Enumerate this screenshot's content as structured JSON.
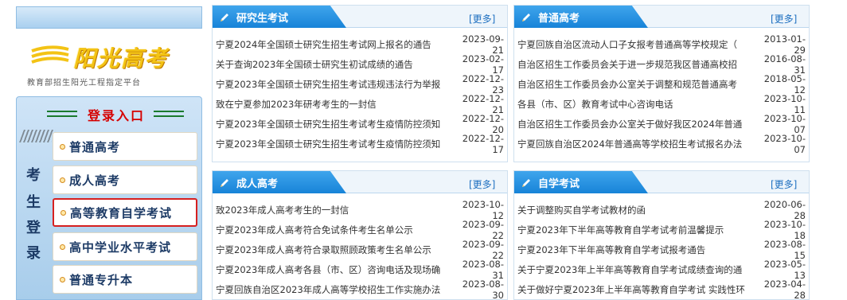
{
  "logo": {
    "title": "阳光高考",
    "subtitle": "教育部招生阳光工程指定平台"
  },
  "login": {
    "title": "登录入口",
    "side_chars": [
      "考",
      "生",
      "登",
      "录"
    ],
    "menu": [
      {
        "label": "普通高考"
      },
      {
        "label": "成人高考"
      },
      {
        "label": "高等教育自学考试"
      },
      {
        "label": "高中学业水平考试"
      },
      {
        "label": "普通专升本"
      }
    ]
  },
  "panels": [
    {
      "title": "研究生考试",
      "more": "[更多]",
      "items": [
        {
          "title": "宁夏2024年全国硕士研究生招生考试网上报名的通告",
          "date": "2023-09-21"
        },
        {
          "title": "关于查询2023年全国硕士研究生初试成绩的通告",
          "date": "2023-02-17"
        },
        {
          "title": "宁夏2023年全国硕士研究生招生考试违规违法行为举报",
          "date": "2022-12-23"
        },
        {
          "title": "致在宁夏参加2023年研考考生的一封信",
          "date": "2022-12-21"
        },
        {
          "title": "宁夏2023年全国硕士研究生招生考试考生疫情防控须知",
          "date": "2022-12-20"
        },
        {
          "title": "宁夏2023年全国硕士研究生招生考试考生疫情防控须知",
          "date": "2022-12-17"
        }
      ]
    },
    {
      "title": "普通高考",
      "more": "[更多]",
      "items": [
        {
          "title": "宁夏回族自治区流动人口子女报考普通高等学校规定（",
          "date": "2013-01-29"
        },
        {
          "title": "自治区招生工作委员会关于进一步规范我区普通高校招",
          "date": "2016-08-31"
        },
        {
          "title": "自治区招生工作委员会办公室关于调整和规范普通高考",
          "date": "2018-05-12"
        },
        {
          "title": "各县（市、区）教育考试中心咨询电话",
          "date": "2023-10-11"
        },
        {
          "title": "自治区招生工作委员会办公室关于做好我区2024年普通",
          "date": "2023-10-07"
        },
        {
          "title": "宁夏回族自治区2024年普通高等学校招生考试报名办法",
          "date": "2023-10-07"
        }
      ]
    },
    {
      "title": "成人高考",
      "more": "[更多]",
      "items": [
        {
          "title": "致2023年成人高考考生的一封信",
          "date": "2023-10-12"
        },
        {
          "title": "宁夏2023年成人高考符合免试条件考生名单公示",
          "date": "2023-09-22"
        },
        {
          "title": "宁夏2023年成人高考符合录取照顾政策考生名单公示",
          "date": "2023-09-22"
        },
        {
          "title": "宁夏2023年成人高考各县（市、区）咨询电话及现场确",
          "date": "2023-08-31"
        },
        {
          "title": "宁夏回族自治区2023年成人高等学校招生工作实施办法",
          "date": "2023-08-30"
        }
      ]
    },
    {
      "title": "自学考试",
      "more": "[更多]",
      "items": [
        {
          "title": "关于调整购买自学考试教材的函",
          "date": "2020-06-28"
        },
        {
          "title": "宁夏2023年下半年高等教育自学考试考前温馨提示",
          "date": "2023-10-18"
        },
        {
          "title": "宁夏2023年下半年高等教育自学考试报考通告",
          "date": "2023-08-15"
        },
        {
          "title": "关于宁夏2023年上半年高等教育自学考试成绩查询的通",
          "date": "2023-05-13"
        },
        {
          "title": "关于做好宁夏2023年上半年高等教育自学考试 实践性环",
          "date": "2023-04-28"
        }
      ]
    }
  ]
}
